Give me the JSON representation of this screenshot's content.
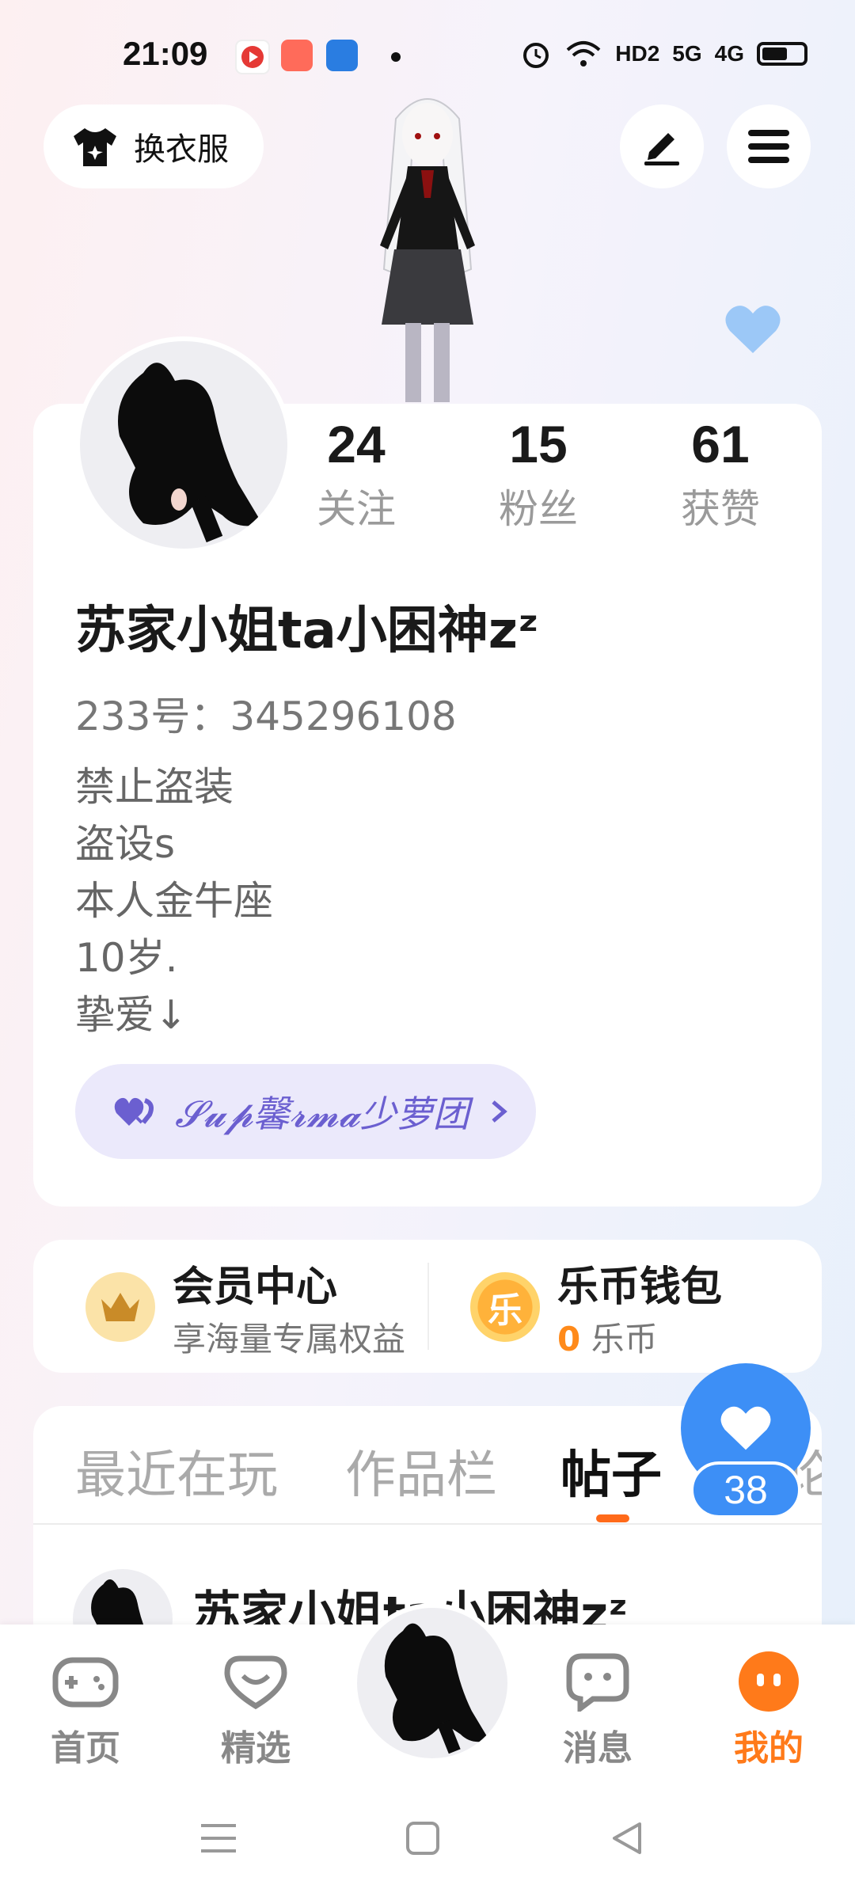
{
  "status_bar": {
    "time": "21:09",
    "network_labels": [
      "HD2",
      "5G",
      "4G"
    ]
  },
  "header": {
    "dress_button_label": "换衣服",
    "edit_icon": "pen-icon",
    "menu_icon": "hamburger-menu-icon"
  },
  "profile": {
    "stats": [
      {
        "value": "24",
        "label": "关注"
      },
      {
        "value": "15",
        "label": "粉丝"
      },
      {
        "value": "61",
        "label": "获赞"
      }
    ],
    "username": "苏家小姐ta小困神zᶻ",
    "user_id": "233号：345296108",
    "bio": [
      "禁止盗装",
      "盗设s",
      "本人金牛座",
      "10岁.",
      "挚爱↓"
    ],
    "group_label": "𝓢𝓾𝓹馨𝓻𝓶𝓪少萝团"
  },
  "member": {
    "title": "会员中心",
    "subtitle": "享海量专属权益"
  },
  "wallet": {
    "title": "乐币钱包",
    "amount": "0",
    "unit": "乐币",
    "coin_char": "乐"
  },
  "tabs": {
    "items": [
      "最近在玩",
      "作品栏",
      "帖子",
      "论"
    ],
    "active_index": 2
  },
  "fab": {
    "count": "38"
  },
  "post_preview": {
    "author": "苏家小姐ta小困神zᶻ"
  },
  "bottom_nav": {
    "items": [
      {
        "label": "首页",
        "icon": "gamepad-icon"
      },
      {
        "label": "精选",
        "icon": "heart-chat-icon"
      },
      {
        "label": "",
        "icon": "avatar-center"
      },
      {
        "label": "消息",
        "icon": "message-icon"
      },
      {
        "label": "我的",
        "icon": "face-icon"
      }
    ],
    "active_index": 4,
    "active_color": "#ff7a1a"
  },
  "colors": {
    "accent_blue": "#3d8ff6",
    "accent_orange": "#ff6a1a",
    "group_purple": "#6b5fd0"
  }
}
